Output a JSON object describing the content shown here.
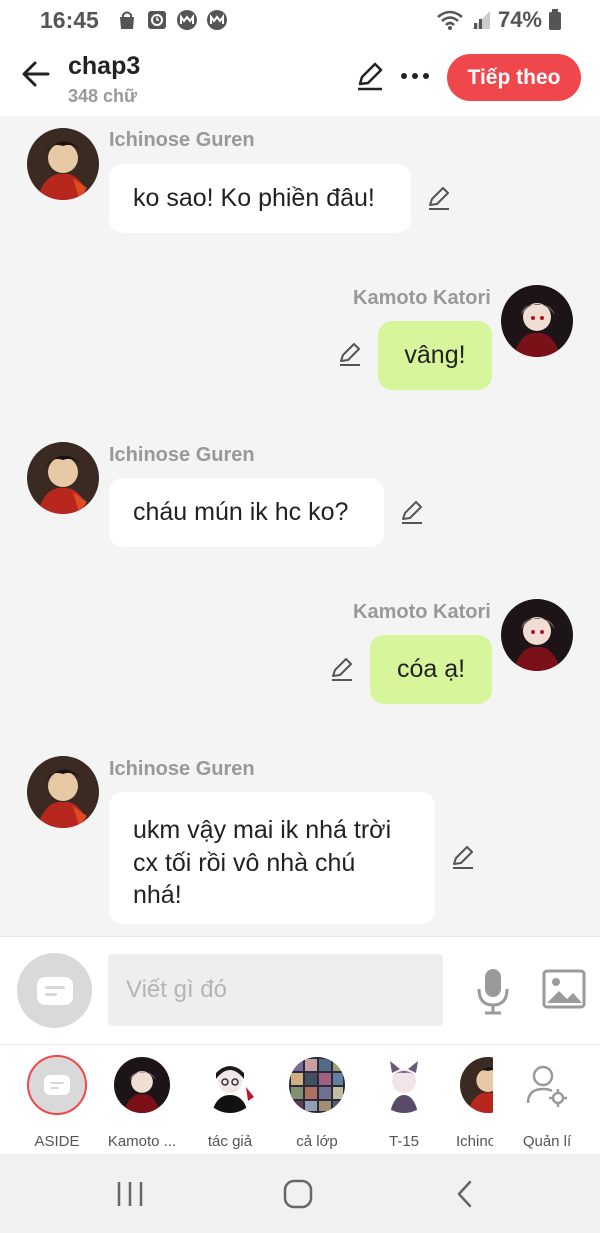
{
  "status_bar": {
    "time": "16:45",
    "battery": "74%",
    "notification_icons": [
      "bag-icon",
      "clock-app-icon",
      "m-app-icon",
      "m-app-icon"
    ],
    "right_icons": [
      "wifi-icon",
      "signal-icon",
      "battery-icon"
    ]
  },
  "header": {
    "title": "chap3",
    "subtitle": "348 chữ",
    "next_label": "Tiếp theo",
    "accent_color": "#f0474d"
  },
  "messages": [
    {
      "side": "left",
      "sender": "Ichinose Guren",
      "text": "ko sao! Ko phiền đâu!"
    },
    {
      "side": "right",
      "sender": "Kamoto Katori",
      "text": "vâng!"
    },
    {
      "side": "left",
      "sender": "Ichinose Guren",
      "text": "cháu mún ik hc ko?"
    },
    {
      "side": "right",
      "sender": "Kamoto Katori",
      "text": "cóa ạ!"
    },
    {
      "side": "left",
      "sender": "Ichinose Guren",
      "lines": [
        "ukm vậy mai ik nhá trời",
        "cx tối rồi vô nhà chú",
        "nhá!"
      ]
    }
  ],
  "input": {
    "placeholder": "Viết gì đó"
  },
  "characters": [
    {
      "label": "ASIDE"
    },
    {
      "label": "Kamoto ..."
    },
    {
      "label": "tác giả"
    },
    {
      "label": "cả lớp"
    },
    {
      "label": "T-15"
    },
    {
      "label": "Ichino"
    },
    {
      "label": "Quản lí"
    }
  ],
  "colors": {
    "right_bubble": "#d7f59a",
    "left_bubble": "#ffffff",
    "background": "#f4f4f4"
  }
}
